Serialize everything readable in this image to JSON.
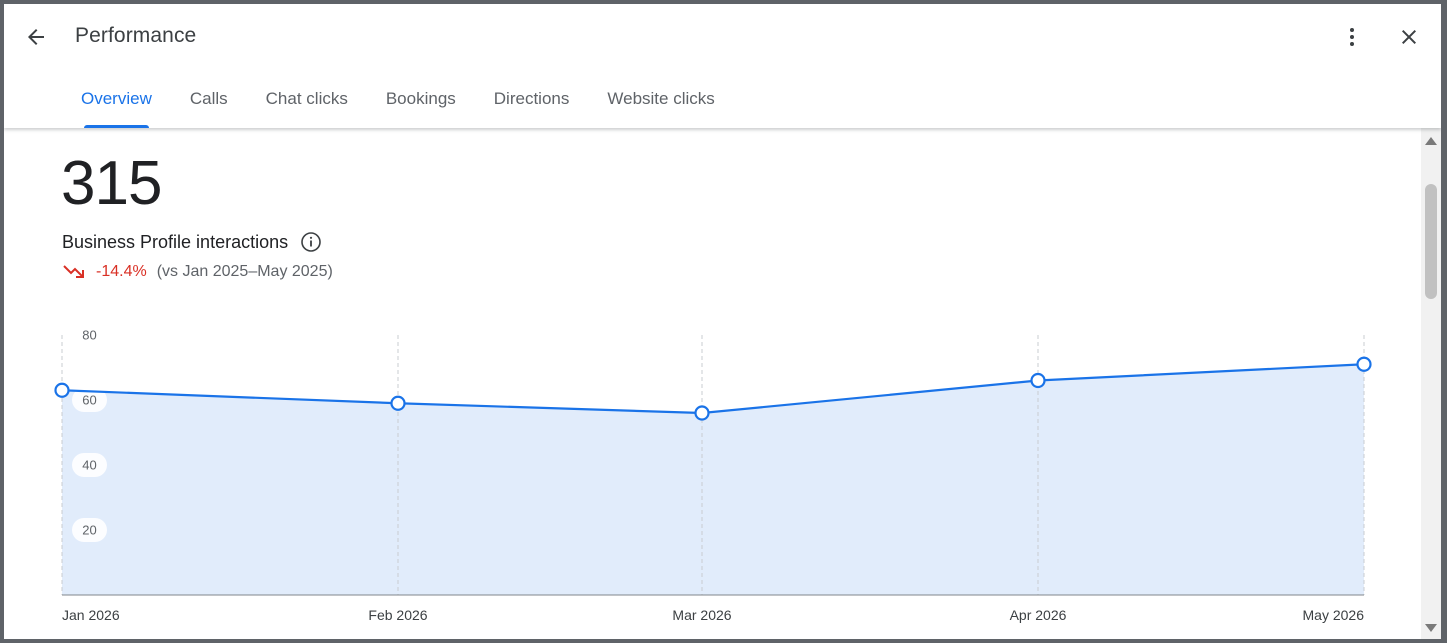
{
  "header": {
    "title": "Performance",
    "back_icon": "arrow-back-icon",
    "more_icon": "more-vert-icon",
    "close_icon": "close-icon"
  },
  "tabs": [
    {
      "label": "Overview",
      "active": true
    },
    {
      "label": "Calls",
      "active": false
    },
    {
      "label": "Chat clicks",
      "active": false
    },
    {
      "label": "Bookings",
      "active": false
    },
    {
      "label": "Directions",
      "active": false
    },
    {
      "label": "Website clicks",
      "active": false
    }
  ],
  "summary": {
    "total": "315",
    "label": "Business Profile interactions",
    "change": "-14.4%",
    "comparison": "(vs Jan 2025–May 2025)",
    "trend_icon": "trending-down-icon",
    "info_icon": "info-icon"
  },
  "colors": {
    "accent": "#1a73e8",
    "line": "#1a73e8",
    "area": "#e1ecfb",
    "negative": "#d93025"
  },
  "chart_data": {
    "type": "area",
    "x": [
      "Jan 2026",
      "Feb 2026",
      "Mar 2026",
      "Apr 2026",
      "May 2026"
    ],
    "series": [
      {
        "values": [
          63,
          59,
          56,
          66,
          71
        ]
      }
    ],
    "ylim": [
      0,
      80
    ],
    "yticks": [
      20,
      40,
      60,
      80
    ],
    "grid": "vertical dashed",
    "markers": "hollow circles"
  }
}
